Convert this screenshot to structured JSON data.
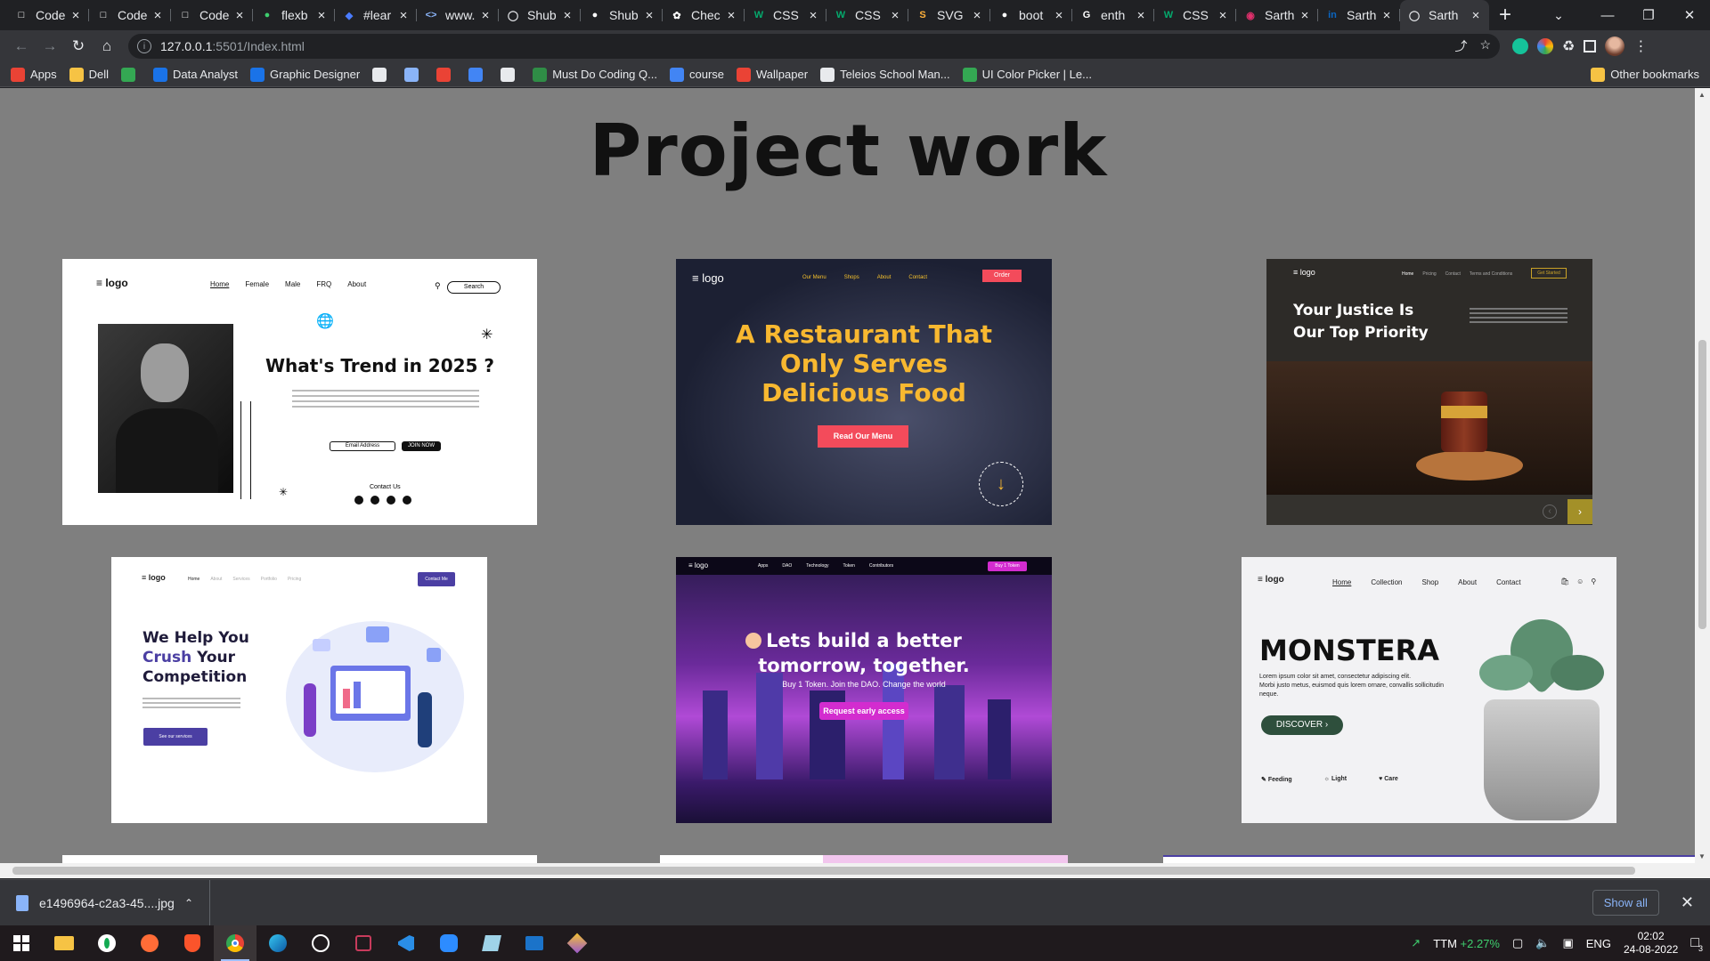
{
  "tabs": [
    {
      "title": "Code",
      "icon": "codepen-icon"
    },
    {
      "title": "Code",
      "icon": "codepen-icon"
    },
    {
      "title": "Code",
      "icon": "codepen-icon"
    },
    {
      "title": "flexb",
      "icon": "frog-icon"
    },
    {
      "title": "#lear",
      "icon": "diamond-icon"
    },
    {
      "title": "www.",
      "icon": "code-icon"
    },
    {
      "title": "Shub",
      "icon": "globe-icon"
    },
    {
      "title": "Shub",
      "icon": "github-icon"
    },
    {
      "title": "Chec",
      "icon": "openai-icon"
    },
    {
      "title": "CSS",
      "icon": "w3-icon"
    },
    {
      "title": "CSS",
      "icon": "w3-icon"
    },
    {
      "title": "SVG",
      "icon": "svg-icon"
    },
    {
      "title": "boot",
      "icon": "github-icon"
    },
    {
      "title": "enth",
      "icon": "google-icon"
    },
    {
      "title": "CSS",
      "icon": "w3-icon"
    },
    {
      "title": "Sarth",
      "icon": "instagram-icon"
    },
    {
      "title": "Sarth",
      "icon": "linkedin-icon"
    },
    {
      "title": "Sarth",
      "icon": "globe-icon",
      "active": true
    }
  ],
  "address": {
    "host": "127.0.0.1",
    "path": ":5501/Index.html"
  },
  "bookmarks": [
    {
      "label": "Apps",
      "icon": "apps-grid-icon",
      "color": "#ea4335"
    },
    {
      "label": "Dell",
      "icon": "folder-icon",
      "color": "#f6c344"
    },
    {
      "label": "",
      "icon": "cloud-icon",
      "color": "#34a853"
    },
    {
      "label": "Data Analyst",
      "icon": "bookmark-icon",
      "color": "#1a73e8"
    },
    {
      "label": "Graphic Designer",
      "icon": "bookmark-icon",
      "color": "#1a73e8"
    },
    {
      "label": "",
      "icon": "globe-icon",
      "color": "#e8eaed"
    },
    {
      "label": "",
      "icon": "drive-icon",
      "color": "#8ab4f8"
    },
    {
      "label": "",
      "icon": "v-icon",
      "color": "#ea4335"
    },
    {
      "label": "",
      "icon": "tools-icon",
      "color": "#4285f4"
    },
    {
      "label": "",
      "icon": "grid-icon",
      "color": "#e8eaed"
    },
    {
      "label": "Must Do Coding Q...",
      "icon": "gfg-icon",
      "color": "#2f8d46"
    },
    {
      "label": "course",
      "icon": "c-icon",
      "color": "#4285f4"
    },
    {
      "label": "Wallpaper",
      "icon": "flame-icon",
      "color": "#ea4335"
    },
    {
      "label": "Teleios School Man...",
      "icon": "page-icon",
      "color": "#e8eaed"
    },
    {
      "label": "UI Color Picker | Le...",
      "icon": "picker-icon",
      "color": "#34a853"
    }
  ],
  "other_bookmarks": "Other bookmarks",
  "page": {
    "title": "Project work",
    "cards": [
      {
        "name": "fashion",
        "logo": "logo",
        "nav": [
          "Home",
          "Female",
          "Male",
          "FRQ",
          "About"
        ],
        "search": "Search",
        "headline": "What's Trend in 2025 ?",
        "email": "Email Address",
        "join": "JOIN NOW",
        "contact": "Contact Us"
      },
      {
        "name": "restaurant",
        "logo": "logo",
        "nav": [
          "Our Menu",
          "Shops",
          "About",
          "Contact"
        ],
        "order": "Order",
        "headline1": "A Restaurant That",
        "headline2": "Only Serves",
        "headline3": "Delicious Food",
        "cta": "Read Our Menu",
        "scroll": "scroll down"
      },
      {
        "name": "law",
        "logo": "logo",
        "nav": [
          "Home",
          "Pricing",
          "Contact",
          "Terms and Conditions"
        ],
        "cta": "Get Started",
        "headline1": "Your Justice Is",
        "headline2": "Our Top Priority"
      },
      {
        "name": "marketing",
        "logo": "logo",
        "nav": [
          "Home",
          "About",
          "Services",
          "Portfolio",
          "Pricing"
        ],
        "cta": "Contact Me",
        "headline1": "We Help You",
        "headline2a": "Crush",
        "headline2b": "Your",
        "headline3": "Competition",
        "button": "See our services"
      },
      {
        "name": "dao",
        "logo": "logo",
        "nav": [
          "Apps",
          "DAO",
          "Technology",
          "Token",
          "Contributors"
        ],
        "cta": "Buy 1 Token",
        "headline1": "Lets build a better",
        "headline2": "tomorrow, together.",
        "sub": "Buy 1 Token. Join the DAO. Change the world",
        "button": "Request early access"
      },
      {
        "name": "plant",
        "logo": "logo",
        "nav": [
          "Home",
          "Collection",
          "Shop",
          "About",
          "Contact"
        ],
        "headline": "MONSTERA",
        "bullets": [
          "Lorem ipsum color sit amet, consectetur adipiscing elit.",
          "Morbi justo metus, euismod quis lorem ornare, convallis sollicitudin neque."
        ],
        "button": "DISCOVER",
        "features": [
          "Feeding",
          "Light",
          "Care"
        ]
      }
    ]
  },
  "downloads": {
    "file": "e1496964-c2a3-45....jpg",
    "show_all": "Show all"
  },
  "taskbar": {
    "stock_name": "TTM",
    "stock_change": "+2.27%",
    "lang": "ENG",
    "time": "02:02",
    "date": "24-08-2022",
    "notifications": "3"
  }
}
